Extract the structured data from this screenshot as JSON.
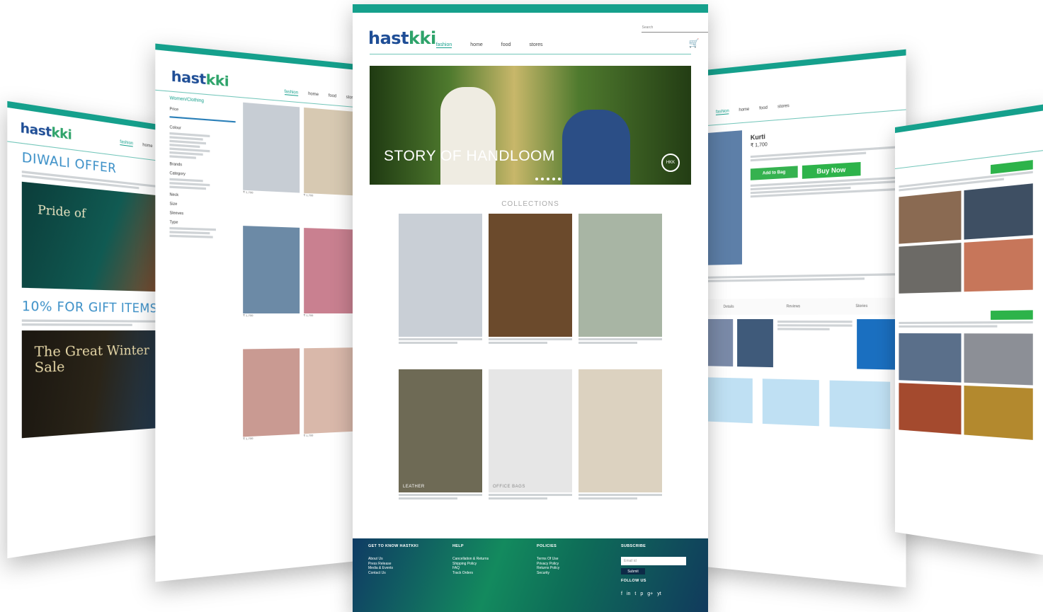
{
  "brand": {
    "logo_main": "hast",
    "logo_accent": "kki"
  },
  "nav": {
    "items": [
      "fashion",
      "home",
      "food",
      "stores"
    ]
  },
  "offers_page": {
    "title1": "DIWALI OFFER",
    "banner1_text": "Pride of",
    "title2": "10% FOR GIFT ITEMS",
    "banner2_text": "The Great Winter Sale"
  },
  "listing_page": {
    "filter_title": "Women/Clothing",
    "filters": [
      "Price",
      "Colour",
      "Brands",
      "Category",
      "Neck",
      "Size",
      "Sleeves",
      "Type"
    ],
    "product_price": "₹ 1,700"
  },
  "home_page": {
    "search_placeholder": "Search",
    "hero_text": "STORY OF HANDLOOM",
    "hero_badge": "HKK",
    "collections_heading": "COLLECTIONS",
    "collections": [
      {
        "label": "",
        "color": "#c9cfd6"
      },
      {
        "label": "",
        "color": "#6b4a2c"
      },
      {
        "label": "",
        "color": "#a8b5a4"
      },
      {
        "label": "LEATHER",
        "color": "#6e6a55"
      },
      {
        "label": "OFFICE BAGS",
        "color": "#e6e6e6"
      },
      {
        "label": "",
        "color": "#dcd2c0"
      }
    ],
    "footer": {
      "col1_title": "GET TO KNOW HASTKKI",
      "col1_links": [
        "About Us",
        "Press Release",
        "Media & Events",
        "Contact Us"
      ],
      "col2_title": "HELP",
      "col2_links": [
        "Cancellation & Returns",
        "Shipping Policy",
        "FAQ",
        "Track Orders"
      ],
      "col3_title": "POLICIES",
      "col3_links": [
        "Terms Of Use",
        "Privacy Policy",
        "Returns Policy",
        "Security"
      ],
      "col4_title": "SUBSCRIBE",
      "email_placeholder": "Email id",
      "submit_label": "Submit",
      "follow_label": "FOLLOW US",
      "social_icons": [
        "f",
        "in",
        "t",
        "p",
        "g+",
        "yt"
      ]
    }
  },
  "product_page": {
    "product_name": "Kurti",
    "price": "₹ 1,700",
    "add_to_bag": "Add to Bag",
    "buy_now": "Buy Now",
    "tabs": [
      "Details",
      "Reviews",
      "Stories"
    ]
  },
  "colors": {
    "teal": "#15a08c",
    "logo_blue": "#1f4e96",
    "green_button": "#2db34a",
    "footer_blue": "#0f3b64"
  }
}
